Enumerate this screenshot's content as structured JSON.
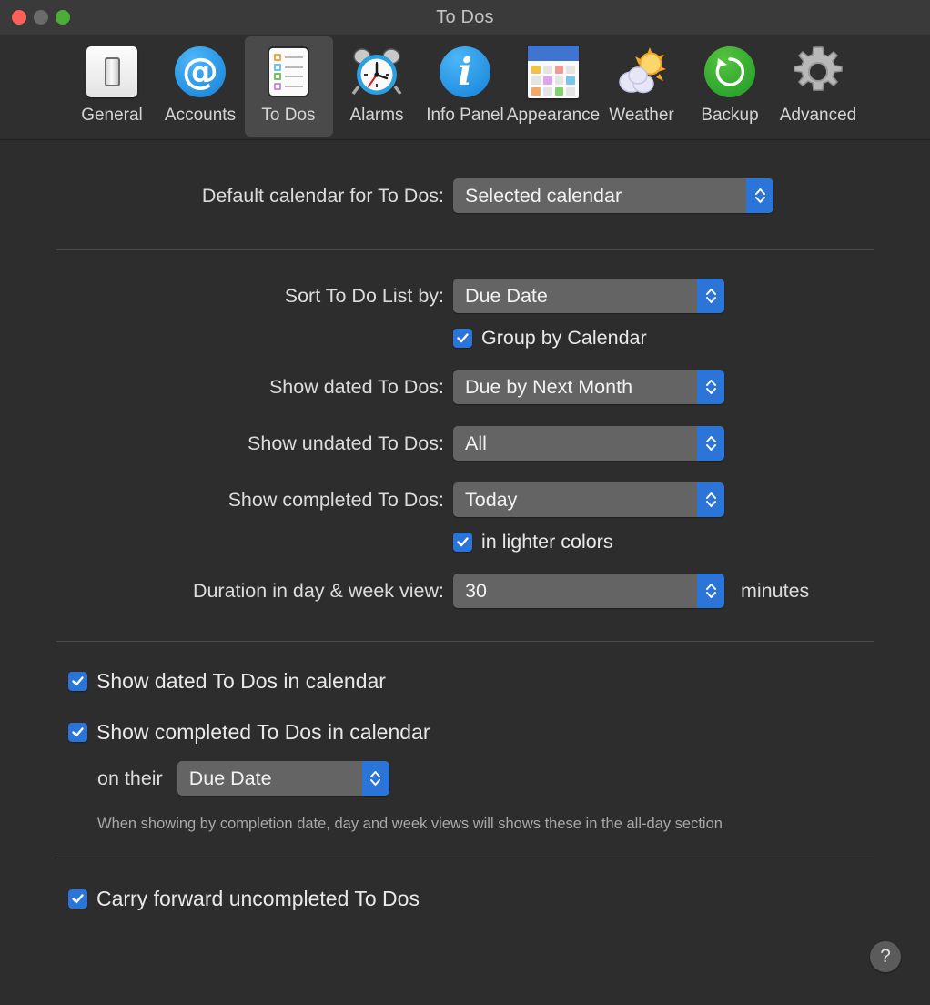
{
  "window": {
    "title": "To Dos",
    "traffic_lights": [
      "close",
      "minimize",
      "zoom"
    ]
  },
  "toolbar": {
    "tabs": [
      {
        "label": "General",
        "icon": "light-switch-icon",
        "selected": false
      },
      {
        "label": "Accounts",
        "icon": "at-sign-icon",
        "selected": false
      },
      {
        "label": "To Dos",
        "icon": "checklist-icon",
        "selected": true
      },
      {
        "label": "Alarms",
        "icon": "alarm-clock-icon",
        "selected": false
      },
      {
        "label": "Info Panel",
        "icon": "info-circle-icon",
        "selected": false
      },
      {
        "label": "Appearance",
        "icon": "calendar-grid-icon",
        "selected": false
      },
      {
        "label": "Weather",
        "icon": "sun-cloud-icon",
        "selected": false
      },
      {
        "label": "Backup",
        "icon": "restore-circle-icon",
        "selected": false
      },
      {
        "label": "Advanced",
        "icon": "gear-icon",
        "selected": false
      }
    ]
  },
  "settings": {
    "default_calendar": {
      "label": "Default calendar for To Dos:",
      "value": "Selected calendar"
    },
    "sort_by": {
      "label": "Sort To Do List by:",
      "value": "Due Date"
    },
    "group_by_calendar": {
      "label": "Group by Calendar",
      "checked": true
    },
    "show_dated": {
      "label": "Show dated To Dos:",
      "value": "Due by Next Month"
    },
    "show_undated": {
      "label": "Show undated To Dos:",
      "value": "All"
    },
    "show_completed": {
      "label": "Show completed To Dos:",
      "value": "Today"
    },
    "lighter_colors": {
      "label": "in lighter colors",
      "checked": true
    },
    "duration": {
      "label": "Duration in day & week view:",
      "value": "30",
      "unit": "minutes"
    },
    "show_dated_in_calendar": {
      "label": "Show dated To Dos in calendar",
      "checked": true
    },
    "show_completed_in_calendar": {
      "label": "Show completed To Dos in calendar",
      "checked": true
    },
    "on_their": {
      "label": "on their",
      "value": "Due Date"
    },
    "completion_hint": "When showing by completion date, day and week views will shows these in the all-day section",
    "carry_forward": {
      "label": "Carry forward uncompleted To Dos",
      "checked": true
    }
  },
  "help": {
    "label": "?"
  },
  "colors": {
    "accent_blue": "#2b74d8",
    "window_bg": "#2d2d2d",
    "titlebar_bg": "#3a3a3a",
    "popup_bg": "#646464",
    "close_red": "#ff5f57",
    "minimize_gray": "#6b6b6b",
    "zoom_green": "#4caf35"
  }
}
